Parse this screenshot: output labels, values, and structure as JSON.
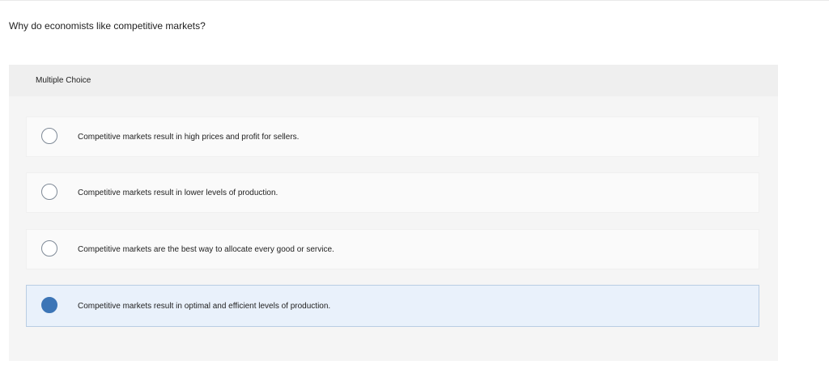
{
  "question": {
    "text": "Why do economists like competitive markets?"
  },
  "panel": {
    "title": "Multiple Choice"
  },
  "options": [
    {
      "text": "Competitive markets result in high prices and profit for sellers.",
      "selected": false
    },
    {
      "text": "Competitive markets result in lower levels of production.",
      "selected": false
    },
    {
      "text": "Competitive markets are the best way to allocate every good or service.",
      "selected": false
    },
    {
      "text": "Competitive markets result in optimal and efficient levels of production.",
      "selected": true
    }
  ],
  "colors": {
    "selected_radio": "#3c75b6",
    "selected_background": "#e9f1fb",
    "selected_border": "#b9cde3",
    "panel_background": "#f5f5f5",
    "header_background": "#efefef"
  }
}
